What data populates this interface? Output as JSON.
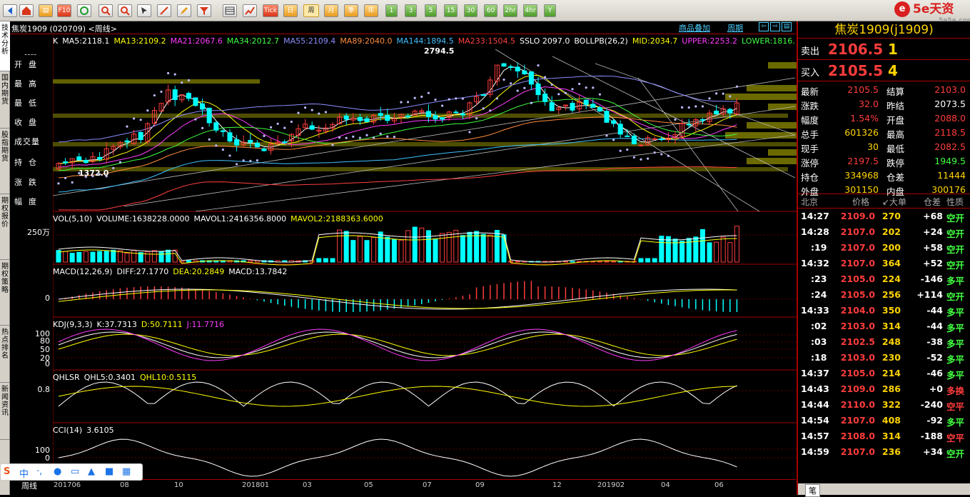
{
  "toolbar": {
    "text_buttons": [
      "Tick",
      "日",
      "周",
      "月",
      "季",
      "年",
      "1",
      "3",
      "5",
      "15",
      "30",
      "60",
      "2hr",
      "4hr",
      "Y"
    ],
    "selected": "周"
  },
  "logo": {
    "text": "5e天资",
    "sub": "5e5e.com"
  },
  "side_tabs": [
    "技术分析",
    "国内期货",
    "股指期货",
    "期权报价",
    "期权策略",
    "热点排名",
    "新闻资讯"
  ],
  "header": {
    "title": "焦炭1909 (020709) <周线>",
    "link1": "商品叠加",
    "link2": "周期"
  },
  "main_chart": {
    "legend": [
      {
        "text": "K",
        "color": "#ffffff"
      },
      {
        "text": "MA5:2118.1",
        "color": "#ffffff"
      },
      {
        "text": "MA13:2109.2",
        "color": "#ffff00"
      },
      {
        "text": "MA21:2067.6",
        "color": "#ff3cff"
      },
      {
        "text": "MA34:2012.7",
        "color": "#40ff40"
      },
      {
        "text": "MA55:2109.4",
        "color": "#8c8cff"
      },
      {
        "text": "MA89:2040.0",
        "color": "#ff8c3c"
      },
      {
        "text": "MA144:1894.5",
        "color": "#40c0ff"
      },
      {
        "text": "MA233:1504.5",
        "color": "#ff4040"
      },
      {
        "text": "SSLO 2097.0",
        "color": "#ffffff"
      },
      {
        "text": "BOLLPB(26,2)",
        "color": "#ffffff"
      },
      {
        "text": "MID:2034.7",
        "color": "#ffff00"
      },
      {
        "text": "UPPER:2253.2",
        "color": "#ff3cff"
      },
      {
        "text": "LOWER:1816.",
        "color": "#40ff40"
      }
    ],
    "high_mark": "2794.5",
    "low_mark": "1372.0"
  },
  "left_table": [
    "开盘",
    "最高",
    "最低",
    "收盘",
    "成交量",
    "持仓",
    "涨跌",
    "幅度"
  ],
  "panels": [
    {
      "name": "vol",
      "legend": [
        {
          "text": "VOL(5,10)",
          "color": "#fff"
        },
        {
          "text": "VOLUME:1638228.0000",
          "color": "#fff"
        },
        {
          "text": "MAVOL1:2416356.8000",
          "color": "#fff"
        },
        {
          "text": "MAVOL2:2188363.6000",
          "color": "#ffff00"
        }
      ],
      "axis": "250万"
    },
    {
      "name": "macd",
      "legend": [
        {
          "text": "MACD(12,26,9)",
          "color": "#fff"
        },
        {
          "text": "DIFF:27.1770",
          "color": "#fff"
        },
        {
          "text": "DEA:20.2849",
          "color": "#ffff00"
        },
        {
          "text": "MACD:13.7842",
          "color": "#fff"
        }
      ],
      "axis": "0"
    },
    {
      "name": "kdj",
      "legend": [
        {
          "text": "KDJ(9,3,3)",
          "color": "#fff"
        },
        {
          "text": "K:37.7313",
          "color": "#fff"
        },
        {
          "text": "D:50.7111",
          "color": "#ffff00"
        },
        {
          "text": "J:11.7716",
          "color": "#ff3cff"
        }
      ],
      "axis_ticks": [
        "100",
        "80",
        "50",
        "20",
        "0"
      ]
    },
    {
      "name": "qhlsr",
      "legend": [
        {
          "text": "QHLSR",
          "color": "#fff"
        },
        {
          "text": "QHL5:0.3401",
          "color": "#fff"
        },
        {
          "text": "QHL10:0.5115",
          "color": "#ffff00"
        }
      ],
      "axis": "0.8"
    },
    {
      "name": "cci",
      "legend": [
        {
          "text": "CCI(14)",
          "color": "#fff"
        },
        {
          "text": "3.6105",
          "color": "#fff"
        }
      ],
      "axis_ticks": [
        "100",
        "0"
      ]
    }
  ],
  "x_axis": {
    "period": "周线",
    "labels": [
      "201706",
      "08",
      "10",
      "201801",
      "03",
      "05",
      "07",
      "09",
      "12",
      "201902",
      "04",
      "06"
    ]
  },
  "right_panel": {
    "title": "焦炭1909(j1909)",
    "sell": {
      "label": "卖出",
      "price": "2106.5",
      "vol": "1"
    },
    "buy": {
      "label": "买入",
      "price": "2105.5",
      "vol": "4"
    },
    "stats": [
      [
        "最新",
        "2105.5",
        "结算",
        "2103.0"
      ],
      [
        "涨跌",
        "32.0",
        "昨结",
        "2073.5"
      ],
      [
        "幅度",
        "1.54%",
        "开盘",
        "2088.0"
      ],
      [
        "总手",
        "601326",
        "最高",
        "2118.5"
      ],
      [
        "现手",
        "30",
        "最低",
        "2082.5"
      ],
      [
        "涨停",
        "2197.5",
        "跌停",
        "1949.5"
      ],
      [
        "持仓",
        "334968",
        "仓差",
        "11444"
      ],
      [
        "外盘",
        "301150",
        "内盘",
        "300176"
      ]
    ],
    "tick_header": [
      "北京",
      "价格",
      "↙大单",
      "仓差",
      "性质"
    ],
    "ticks": [
      [
        "14:27",
        "2109.0",
        "270",
        "+68",
        "空开"
      ],
      [
        "14:28",
        "2107.0",
        "202",
        "+24",
        "空开"
      ],
      [
        ":19",
        "2107.0",
        "200",
        "+58",
        "空开"
      ],
      [
        "14:32",
        "2107.0",
        "364",
        "+52",
        "空开"
      ],
      [
        ":23",
        "2105.0",
        "224",
        "-146",
        "多平"
      ],
      [
        ":24",
        "2105.0",
        "256",
        "+114",
        "空开"
      ],
      [
        "14:33",
        "2104.0",
        "350",
        "-44",
        "多平"
      ],
      [
        ":02",
        "2103.0",
        "314",
        "-44",
        "多平"
      ],
      [
        ":03",
        "2102.5",
        "248",
        "-38",
        "多平"
      ],
      [
        ":18",
        "2103.0",
        "230",
        "-52",
        "多平"
      ],
      [
        "14:37",
        "2105.0",
        "214",
        "-46",
        "多平"
      ],
      [
        "14:43",
        "2109.0",
        "286",
        "+0",
        "多换"
      ],
      [
        "14:44",
        "2110.0",
        "322",
        "-240",
        "空平"
      ],
      [
        "14:54",
        "2107.0",
        "408",
        "-92",
        "多平"
      ],
      [
        "14:57",
        "2108.0",
        "314",
        "-188",
        "空平"
      ],
      [
        "14:59",
        "2107.0",
        "236",
        "+34",
        "空开"
      ]
    ],
    "bottom_tab": "笔"
  },
  "ime": {
    "items": [
      "中",
      "·,",
      "🎤",
      "⌨",
      "👕",
      "▦"
    ]
  },
  "colors": {
    "up": "#ff3c3c",
    "down": "#00ffff",
    "green": "#40ff40",
    "yellow": "#ffd400",
    "grid": "#a00000"
  }
}
